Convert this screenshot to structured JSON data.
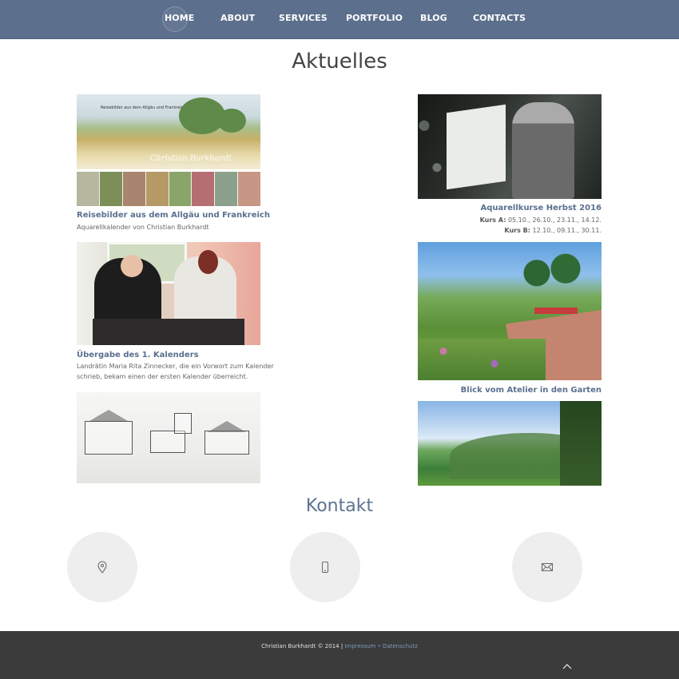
{
  "nav": {
    "items": [
      {
        "label": "HOME"
      },
      {
        "label": "ABOUT"
      },
      {
        "label": "SERVICES"
      },
      {
        "label": "PORTFOLIO"
      },
      {
        "label": "BLOG"
      },
      {
        "label": "CONTACTS"
      }
    ]
  },
  "sections": {
    "aktuelles_title": "Aktuelles",
    "kontakt_title": "Kontakt"
  },
  "images": {
    "calendar_cover_caption": "Reisebilder aus dem Allgäu und Frankreich",
    "calendar_signature": "Christian Burkhardt"
  },
  "articles": {
    "left_1": {
      "title": "Reisebilder aus dem Allgäu und Frankreich",
      "text": "Aquarellkalender von Christian Burkhardt"
    },
    "right_1": {
      "title": "Aquarellkurse Herbst 2016",
      "line1_label": "Kurs A:",
      "line1_value": "05.10., 26.10., 23.11., 14.12.",
      "line2_label": "Kurs B:",
      "line2_value": "12.10., 09.11., 30.11."
    },
    "left_2": {
      "title": "Übergabe des 1. Kalenders",
      "text_line1": "Landrätin Maria Rita Zinnecker, die ein Vorwort zum Kalender",
      "text_line2": "schrieb, bekam einen der ersten Kalender überreicht."
    },
    "right_2": {
      "title": "Blick vom Atelier in den Garten"
    }
  },
  "contact": {
    "icons": [
      "location-pin-icon",
      "mobile-phone-icon",
      "envelope-icon"
    ]
  },
  "footer": {
    "copyright": "Christian Burkhardt © 2014 | ",
    "impressum": "Impressum",
    "separator": " • ",
    "datenschutz": "Datenschutz"
  },
  "colors": {
    "nav_bg": "#5c6f8c",
    "accent": "#5e7392",
    "footer_bg": "#3b3b3b"
  }
}
